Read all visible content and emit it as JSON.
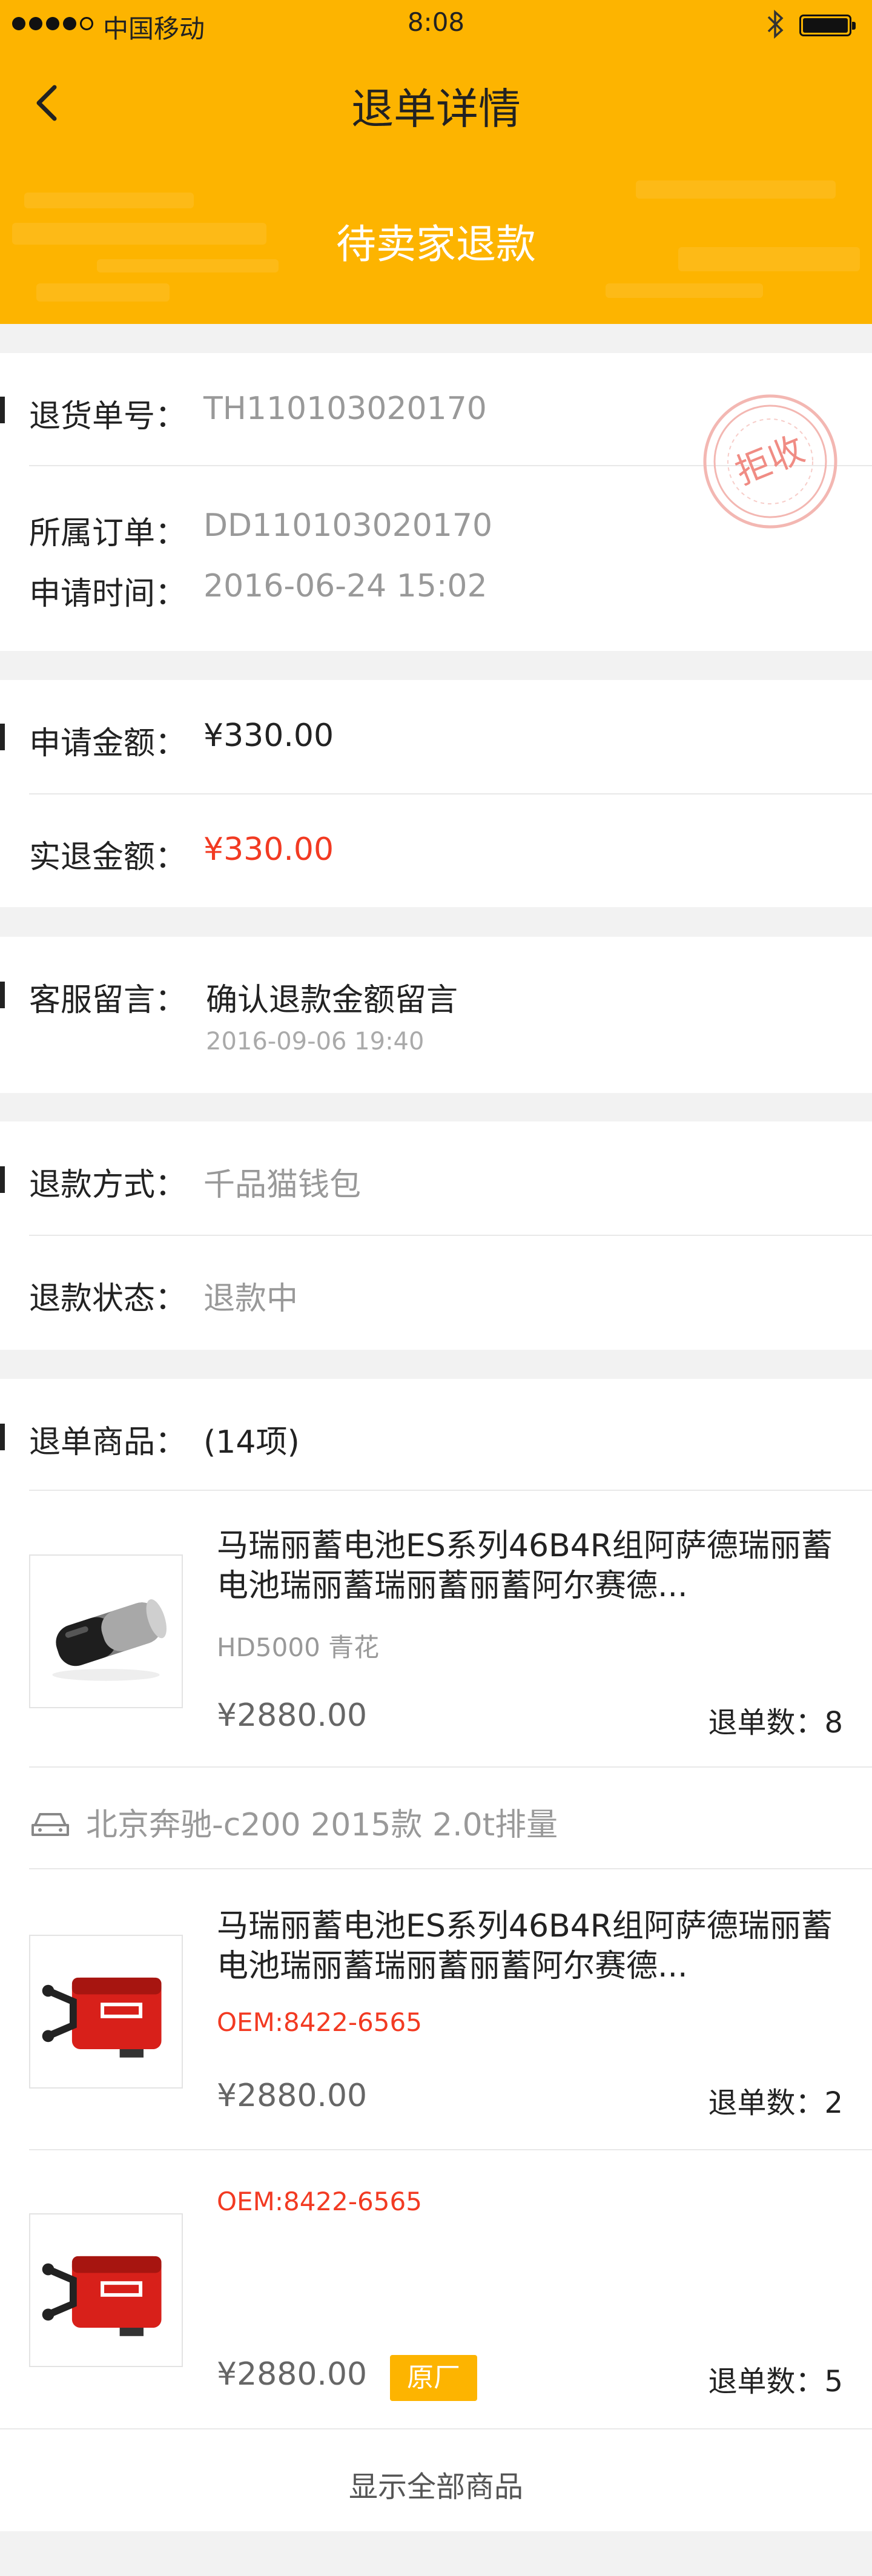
{
  "status_bar": {
    "carrier": "中国移动",
    "time": "8:08",
    "bluetooth_icon": "bluetooth-icon",
    "battery_icon": "battery-icon"
  },
  "nav": {
    "title": "退单详情",
    "back_icon": "chevron-left-icon"
  },
  "banner": {
    "status": "待卖家退款"
  },
  "order_info": {
    "return_no_label": "退货单号：",
    "return_no": "TH110103020170",
    "order_label": "所属订单：",
    "order_no": "DD110103020170",
    "apply_time_label": "申请时间：",
    "apply_time": "2016-06-24  15:02",
    "stamp_text": "拒收"
  },
  "amounts": {
    "apply_label": "申请金额：",
    "apply_amount": "¥330.00",
    "refund_label": "实退金额：",
    "refund_amount": "¥330.00"
  },
  "service_msg": {
    "label": "客服留言：",
    "content": "确认退款金额留言",
    "time": "2016-09-06 19:40"
  },
  "refund": {
    "method_label": "退款方式：",
    "method": "千品猫钱包",
    "status_label": "退款状态：",
    "status": "退款中"
  },
  "goods": {
    "label": "退单商品：",
    "count": "(14项)",
    "car_model": "北京奔驰-c200 2015款 2.0t排量",
    "show_all": "显示全部商品",
    "items": [
      {
        "title": "马瑞丽蓄电池ES系列46B4R组阿萨德瑞丽蓄电池瑞丽蓄瑞丽蓄丽蓄阿尔赛德...",
        "spec": "HD5000   青花",
        "price": "¥2880.00",
        "qty": "退单数：8"
      },
      {
        "title": "马瑞丽蓄电池ES系列46B4R组阿萨德瑞丽蓄电池瑞丽蓄瑞丽蓄丽蓄阿尔赛德...",
        "spec": "OEM:8422-6565",
        "price": "¥2880.00",
        "qty": "退单数：2"
      },
      {
        "spec": "OEM:8422-6565",
        "price": "¥2880.00",
        "badge": "原厂",
        "qty": "退单数：5"
      }
    ]
  },
  "colors": {
    "brand_yellow": "#fdb400",
    "price_red": "#f23a22"
  }
}
